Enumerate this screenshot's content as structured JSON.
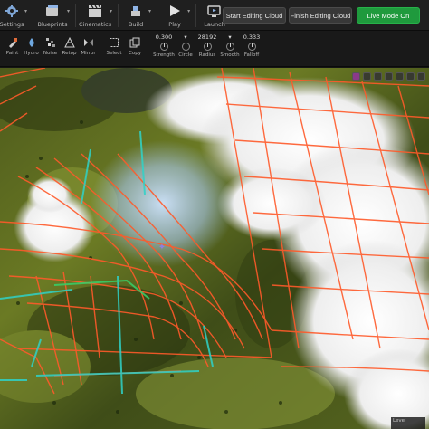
{
  "toolbar": {
    "items": [
      {
        "label": "Settings",
        "icon": "settings-icon"
      },
      {
        "label": "Blueprints",
        "icon": "blueprints-icon"
      },
      {
        "label": "Cinematics",
        "icon": "cinematics-icon"
      },
      {
        "label": "Build",
        "icon": "build-icon"
      },
      {
        "label": "Play",
        "icon": "play-icon"
      },
      {
        "label": "Launch",
        "icon": "launch-icon"
      }
    ],
    "start_editing_label": "Start Editing Cloud",
    "finish_editing_label": "Finish Editing Cloud",
    "live_mode_label": "Live Mode On",
    "live_color": "#1f9a3d"
  },
  "tools": {
    "items": [
      {
        "label": "Paint",
        "icon": "paint-icon"
      },
      {
        "label": "Hydro",
        "icon": "hydro-icon"
      },
      {
        "label": "Noise",
        "icon": "noise-icon"
      },
      {
        "label": "Retop",
        "icon": "retopology-icon"
      },
      {
        "label": "Mirror",
        "icon": "mirror-icon"
      },
      {
        "label": "Select",
        "icon": "select-icon"
      },
      {
        "label": "Copy",
        "icon": "copy-icon"
      }
    ],
    "params": [
      {
        "label": "Strength",
        "value": "0.300"
      },
      {
        "label": "Circle",
        "value": "▾"
      },
      {
        "label": "Radius",
        "value": "28192"
      },
      {
        "label": "Smooth",
        "value": "▾"
      },
      {
        "label": "Falloff",
        "value": "0.333"
      }
    ]
  },
  "viewport": {
    "level_label": "Level",
    "grid_color_warm": "#ff5a2a",
    "grid_color_accent": "#2fd2c8"
  }
}
